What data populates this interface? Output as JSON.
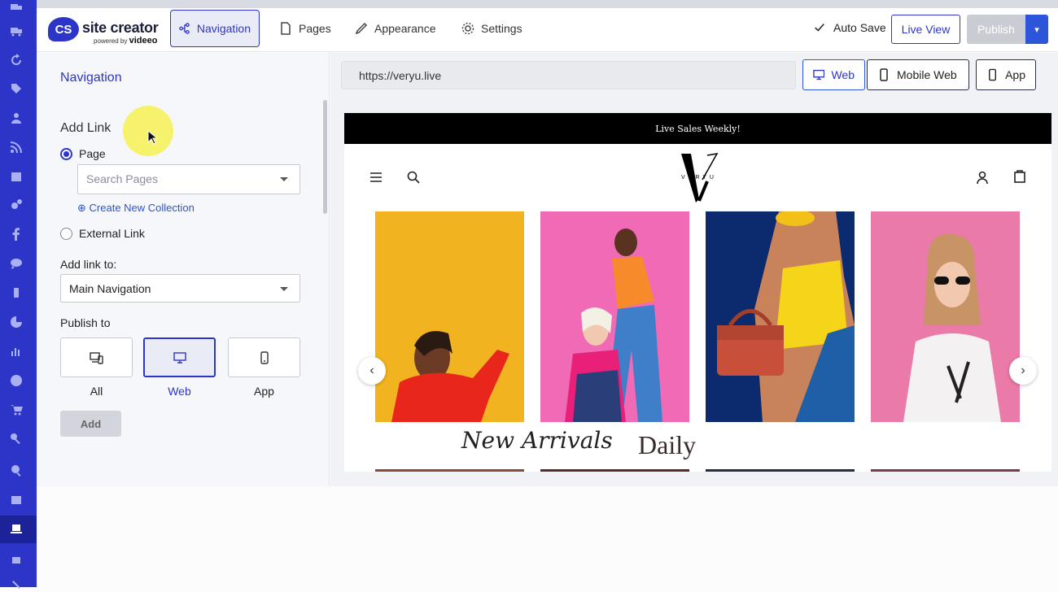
{
  "app": {
    "logo_badge": "CS",
    "logo_text": "site creator",
    "logo_powered": "powered by",
    "logo_brand": "videeo"
  },
  "topnav": {
    "tabs": [
      {
        "label": "Navigation",
        "icon": "navigation-icon",
        "active": true
      },
      {
        "label": "Pages",
        "icon": "page-icon",
        "active": false
      },
      {
        "label": "Appearance",
        "icon": "paintbrush-icon",
        "active": false
      },
      {
        "label": "Settings",
        "icon": "gear-icon",
        "active": false
      }
    ],
    "autosave_label": "Auto Save",
    "live_view_label": "Live View",
    "publish_label": "Publish"
  },
  "panel": {
    "title": "Navigation",
    "add_link_heading": "Add Link",
    "page_option_label": "Page",
    "page_option_selected": true,
    "search_pages_placeholder": "Search Pages",
    "create_collection_label": "Create New Collection",
    "external_link_label": "External Link",
    "add_link_to_label": "Add link to:",
    "add_link_to_value": "Main Navigation",
    "publish_to_label": "Publish to",
    "publish_targets": [
      {
        "label": "All",
        "icon": "devices-icon",
        "selected": false
      },
      {
        "label": "Web",
        "icon": "desktop-icon",
        "selected": true
      },
      {
        "label": "App",
        "icon": "phone-icon",
        "selected": false
      }
    ],
    "add_button_label": "Add"
  },
  "preview": {
    "url": "https://veryu.live",
    "device_buttons": [
      {
        "label": "Web",
        "icon": "desktop-icon",
        "active": true
      },
      {
        "label": "Mobile Web",
        "icon": "phone-icon",
        "active": false
      },
      {
        "label": "App",
        "icon": "phone-icon",
        "active": false
      }
    ],
    "site": {
      "announcement": "Live Sales Weekly!",
      "logo_letter": "V",
      "logo_word": "VERYU",
      "headline_script": "New Arrivals",
      "headline_serif": "Daily"
    }
  },
  "colors": {
    "brand": "#2d35c9",
    "rail": "#2d35c9",
    "announcement_bg": "#000000",
    "photo_1": "#f2b321",
    "photo_2": "#f06ab5",
    "photo_3": "#0c2a6e",
    "photo_4": "#ea7aa8"
  }
}
